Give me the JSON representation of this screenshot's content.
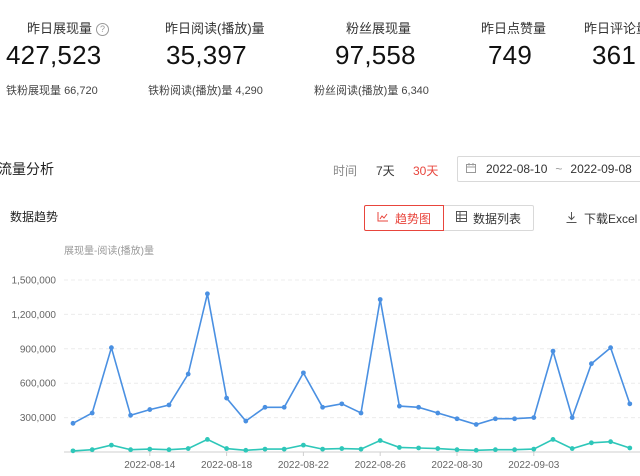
{
  "stats": [
    {
      "label": "昨日展现量",
      "help": "?",
      "value": "427,523",
      "sub_label": "铁粉展现量",
      "sub_value": "66,720"
    },
    {
      "label": "昨日阅读(播放)量",
      "value": "35,397",
      "sub_label": "铁粉阅读(播放)量",
      "sub_value": "4,290"
    },
    {
      "label": "粉丝展现量",
      "value": "97,558",
      "sub_label": "粉丝阅读(播放)量",
      "sub_value": "6,340"
    },
    {
      "label": "昨日点赞量",
      "value": "749"
    },
    {
      "label": "昨日评论量",
      "value": "361"
    }
  ],
  "traffic": {
    "title": "流量分析",
    "range_label": "时间",
    "range_options": [
      "7天",
      "30天"
    ],
    "active_range": "30天",
    "date_start": "2022-08-10",
    "date_sep": "~",
    "date_end": "2022-09-08",
    "accent": "#e8453c"
  },
  "trend": {
    "title": "数据趋势",
    "view_trend": "趋势图",
    "view_list": "数据列表",
    "download": "下载Excel",
    "icons": {
      "trend": "line-chart-icon",
      "list": "table-icon",
      "download": "download-icon",
      "calendar": "calendar-icon"
    }
  },
  "chart_data": {
    "type": "line",
    "legend_text": "展现量-阅读(播放)量",
    "ylim": [
      0,
      1500000
    ],
    "yticks": [
      "300,000",
      "600,000",
      "900,000",
      "1,200,000",
      "1,500,000"
    ],
    "x_tick_labels": [
      "2022-08-14",
      "2022-08-18",
      "2022-08-22",
      "2022-08-26",
      "2022-08-30",
      "2022-09-03"
    ],
    "x": [
      "2022-08-10",
      "2022-08-11",
      "2022-08-12",
      "2022-08-13",
      "2022-08-14",
      "2022-08-15",
      "2022-08-16",
      "2022-08-17",
      "2022-08-18",
      "2022-08-19",
      "2022-08-20",
      "2022-08-21",
      "2022-08-22",
      "2022-08-23",
      "2022-08-24",
      "2022-08-25",
      "2022-08-26",
      "2022-08-27",
      "2022-08-28",
      "2022-08-29",
      "2022-08-30",
      "2022-08-31",
      "2022-09-01",
      "2022-09-02",
      "2022-09-03",
      "2022-09-04",
      "2022-09-05",
      "2022-09-06",
      "2022-09-07",
      "2022-09-08"
    ],
    "series": [
      {
        "color": "#4a90e2",
        "values": [
          250000,
          340000,
          910000,
          320000,
          370000,
          410000,
          680000,
          1380000,
          470000,
          270000,
          390000,
          390000,
          690000,
          390000,
          420000,
          340000,
          1330000,
          400000,
          390000,
          340000,
          290000,
          240000,
          290000,
          290000,
          300000,
          880000,
          300000,
          770000,
          910000,
          420000
        ]
      },
      {
        "color": "#2ec7b9",
        "values": [
          10000,
          20000,
          60000,
          20000,
          25000,
          20000,
          30000,
          110000,
          30000,
          15000,
          25000,
          25000,
          60000,
          25000,
          30000,
          25000,
          100000,
          40000,
          35000,
          30000,
          20000,
          15000,
          20000,
          20000,
          25000,
          110000,
          30000,
          80000,
          90000,
          35000
        ]
      }
    ]
  }
}
